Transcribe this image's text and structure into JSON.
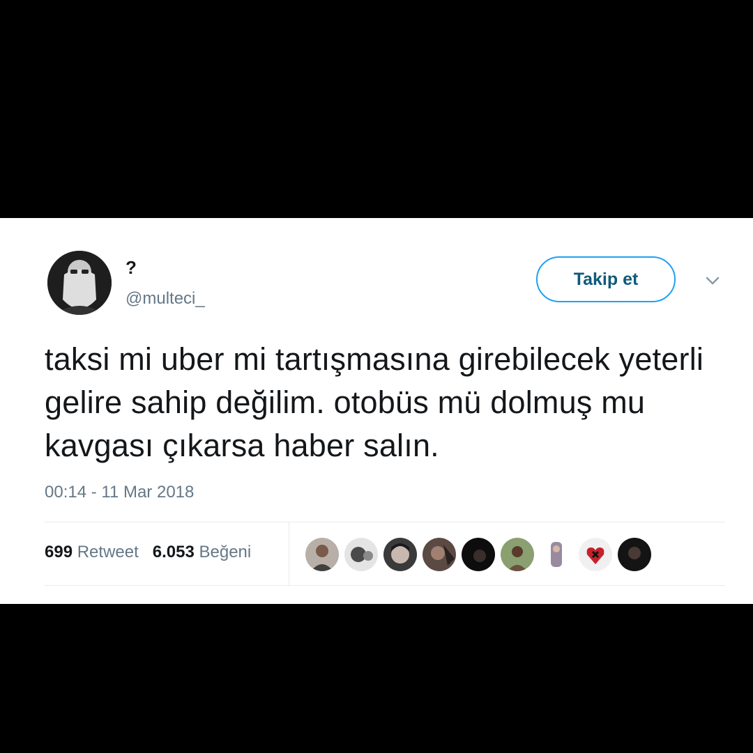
{
  "tweet": {
    "display_name": "?",
    "handle": "@multeci_",
    "follow_label": "Takip et",
    "text": "taksi mi uber mi tartışmasına girebilecek yeterli gelire sahip değilim. otobüs mü dolmuş mu kavgası çıkarsa haber salın.",
    "timestamp": "00:14 - 11 Mar 2018",
    "retweet_count": "699",
    "retweet_label": "Retweet",
    "like_count": "6.053",
    "like_label": "Beğeni"
  },
  "icons": {
    "menu": "chevron-down-icon",
    "avatar": "profile-avatar",
    "likers": "liker-avatar"
  },
  "colors": {
    "accent": "#1da1f2",
    "text": "#14171a",
    "muted": "#657786",
    "divider": "#e6ecf0"
  }
}
